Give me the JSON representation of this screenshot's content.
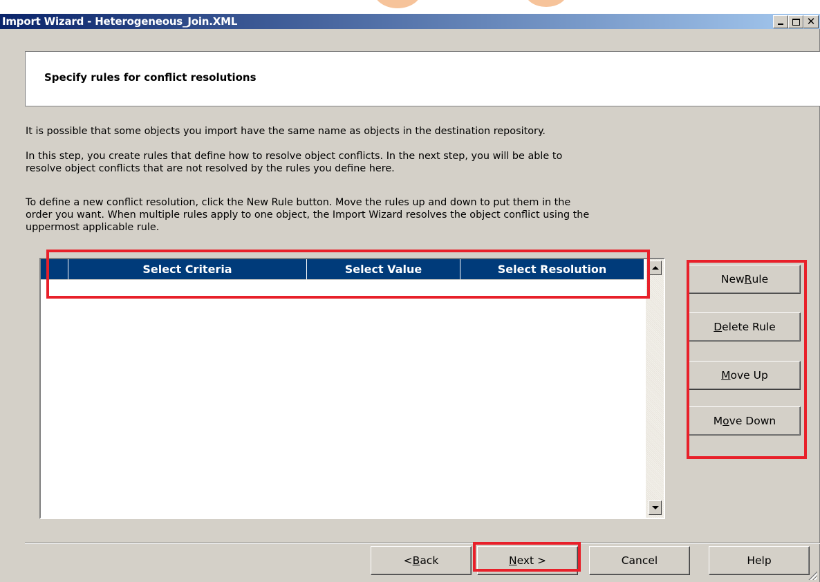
{
  "window": {
    "title": "Import Wizard - Heterogeneous_Join.XML",
    "controls": {
      "minimize": "minimize-icon",
      "maximize": "maximize-icon",
      "close": "close-icon"
    }
  },
  "header": {
    "title": "Specify rules for conflict resolutions"
  },
  "body": {
    "paragraph1": "It is possible that some objects you import have the same name as objects in the destination repository.",
    "paragraph2_line1": "In this step, you create rules that define how to resolve object conflicts. In the next step, you will be able to",
    "paragraph2_line2": "resolve object conflicts that are not resolved by the rules you define here.",
    "paragraph3_line1": "To define a new conflict resolution, click the New Rule button. Move the rules up and down to put them in the",
    "paragraph3_line2": "order you want. When multiple rules apply to one object, the Import Wizard resolves the object conflict using the",
    "paragraph3_line3": "uppermost applicable rule."
  },
  "rules_table": {
    "columns": [
      "Select Criteria",
      "Select Value",
      "Select Resolution"
    ],
    "rows": []
  },
  "side_buttons": {
    "new_rule": {
      "prefix": "New ",
      "key": "R",
      "suffix": "ule"
    },
    "delete_rule": {
      "prefix": "",
      "key": "D",
      "suffix": "elete Rule"
    },
    "move_up": {
      "prefix": "",
      "key": "M",
      "suffix": "ove Up"
    },
    "move_down": {
      "prefix": "M",
      "key": "o",
      "suffix": "ve Down"
    }
  },
  "footer_buttons": {
    "back": {
      "prefix": "< ",
      "key": "B",
      "suffix": "ack"
    },
    "next": {
      "prefix": "",
      "key": "N",
      "suffix": "ext >"
    },
    "cancel": "Cancel",
    "help": "Help"
  },
  "colors": {
    "titlebar_start": "#0a246a",
    "titlebar_end": "#a6caf0",
    "grid_header": "#003b7a",
    "dialog_face": "#d4d0c8",
    "highlight": "#e8202a"
  }
}
